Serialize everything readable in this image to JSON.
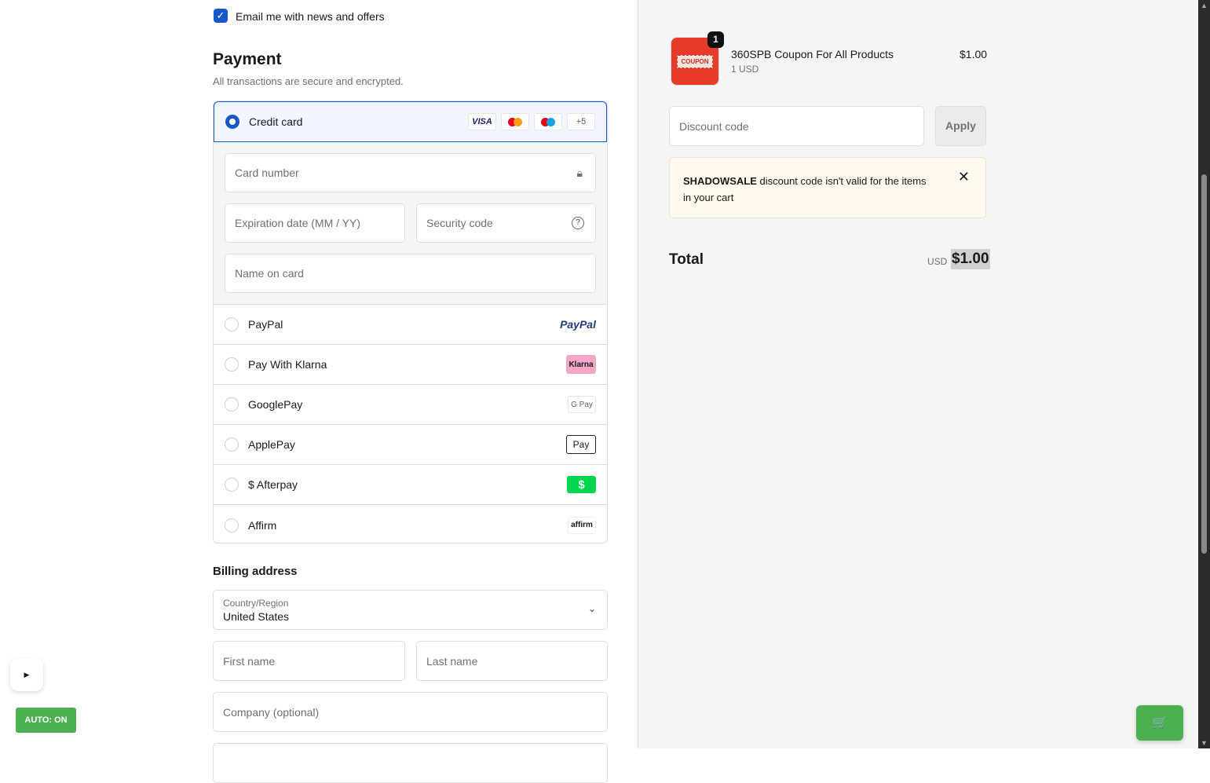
{
  "contact": {
    "email_opt_in": "Email me with news and offers",
    "checked": true
  },
  "payment": {
    "title": "Payment",
    "subtitle": "All transactions are secure and encrypted.",
    "credit_card": {
      "label": "Credit card",
      "cards": [
        "VISA",
        "mastercard",
        "maestro",
        "+5"
      ],
      "card_number": "Card number",
      "expiration": "Expiration date (MM / YY)",
      "security_code": "Security code",
      "name_on_card": "Name on card"
    },
    "methods": [
      {
        "label": "PayPal",
        "logo": "PayPal"
      },
      {
        "label": "Pay With Klarna",
        "logo": "Klarna"
      },
      {
        "label": "GooglePay",
        "logo": "G Pay"
      },
      {
        "label": "ApplePay",
        "logo": "Pay"
      },
      {
        "label": "$ Afterpay",
        "logo": "$"
      },
      {
        "label": "Affirm",
        "logo": "affirm"
      }
    ]
  },
  "billing": {
    "title": "Billing address",
    "country_label": "Country/Region",
    "country_value": "United States",
    "first_name": "First name",
    "last_name": "Last name",
    "company": "Company (optional)"
  },
  "summary": {
    "item": {
      "name": "360SPB Coupon For All Products",
      "variant": "1 USD",
      "price": "$1.00",
      "quantity": "1",
      "image_text": "COUPON"
    },
    "discount_placeholder": "Discount code",
    "apply": "Apply",
    "alert": {
      "code": "SHADOWSALE",
      "message": " discount code isn't valid for the items in your cart"
    },
    "total_label": "Total",
    "currency": "USD",
    "total": "$1.00"
  },
  "widgets": {
    "play": "▶",
    "auto": "AUTO: ON",
    "cart": "🛒"
  },
  "colors": {
    "accent": "#1558c9",
    "auto": "#4caf50"
  }
}
